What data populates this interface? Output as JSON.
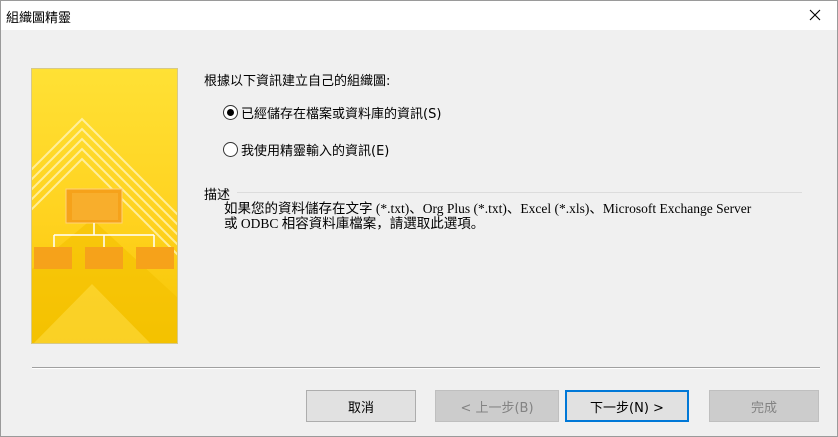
{
  "window": {
    "title": "組織圖精靈"
  },
  "prompt": "根據以下資訊建立自己的組織圖:",
  "options": [
    {
      "label": "已經儲存在檔案或資料庫的資訊(S)",
      "selected": true
    },
    {
      "label": "我使用精靈輸入的資訊(E)",
      "selected": false
    }
  ],
  "description": {
    "label": "描述",
    "line1": "如果您的資料儲存在文字 (*.txt)、Org Plus (*.txt)、Excel (*.xls)、Microsoft Exchange Server",
    "line2": "或 ODBC 相容資料庫檔案，請選取此選項。"
  },
  "buttons": {
    "cancel": "取消",
    "back": "< 上一步(B)",
    "next": "下一步(N) >",
    "finish": "完成"
  },
  "colors": {
    "banner_yellow": "#f9c800",
    "banner_light": "#ffe24a",
    "accent_focus": "#0078d7"
  }
}
